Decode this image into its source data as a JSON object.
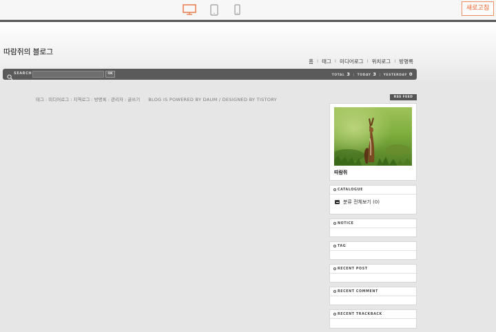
{
  "toolbar": {
    "devices": [
      "desktop-icon",
      "tablet-icon",
      "mobile-icon"
    ],
    "refresh_label": "새로고침",
    "accent": "#e85d25"
  },
  "blog": {
    "title": "따람쥐의 블로그",
    "nav": [
      "홈",
      "태그",
      "미디어로그",
      "위치로그",
      "방명록"
    ]
  },
  "searchbar": {
    "label": "SEARCH",
    "ok_label": "OK",
    "stats": {
      "total_label": "TOTAL",
      "total": "3",
      "today_label": "TODAY",
      "today": "3",
      "yesterday_label": "YESTERDAY",
      "yesterday": "0"
    }
  },
  "content": {
    "links": "태그 : 미디어로그 : 지역로그 : 방명록 : 관리자 : 글쓰기",
    "powered": "BLOG IS POWERED BY DAUM / DESIGNED BY TISTORY"
  },
  "sidebar": {
    "rss_label": "RSS FEED",
    "profile_name": "따람쥐",
    "catalogue_title": "CATALOGUE",
    "catalogue_item": "분류 전체보기 (0)",
    "notice_title": "NOTICE",
    "tag_title": "TAG",
    "recent_post_title": "RECENT POST",
    "recent_comment_title": "RECENT COMMENT",
    "recent_trackback_title": "RECENT TRACKBACK"
  }
}
